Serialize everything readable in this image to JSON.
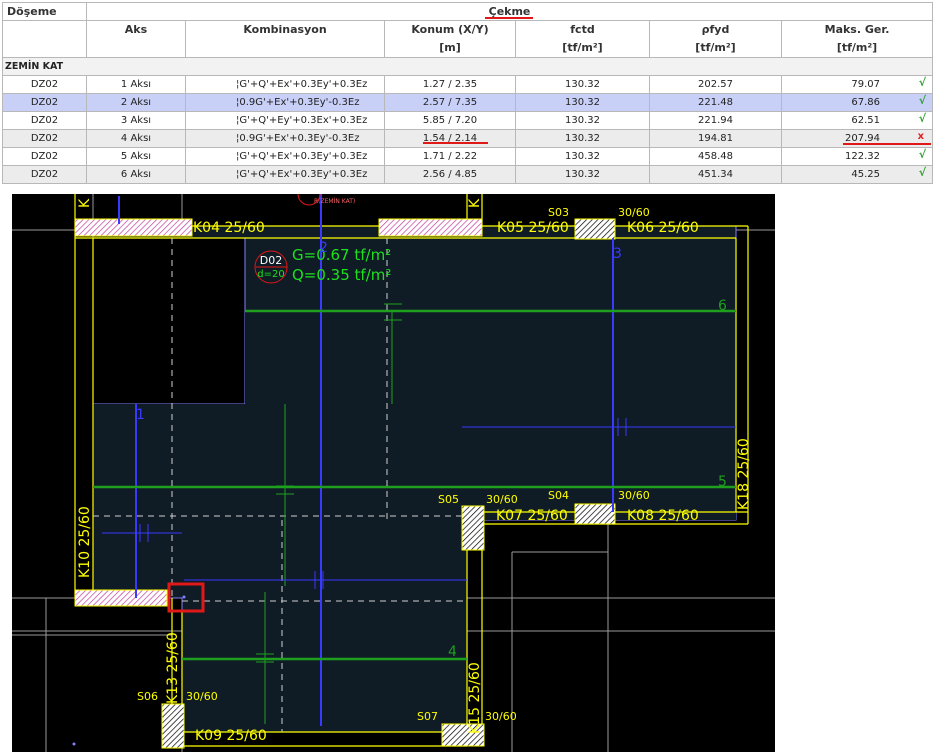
{
  "table": {
    "group_header": {
      "doseme": "Döşeme",
      "cekme": "Çekme"
    },
    "columns": {
      "aks": "Aks",
      "kombinasyon": "Kombinasyon",
      "konum": "Konum (X/Y)",
      "konum_unit": "[m]",
      "fctd": "fctd",
      "fctd_unit": "[tf/m²]",
      "pfyd": "ρfyd",
      "pfyd_unit": "[tf/m²]",
      "maks": "Maks. Ger.",
      "maks_unit": "[tf/m²]"
    },
    "section": "ZEMİN KAT",
    "rows": [
      {
        "doseme": "DZ02",
        "aks": "1 Aksı",
        "komb": "¦G'+Q'+Ex'+0.3Ey'+0.3Ez",
        "konum": "1.27 / 2.35",
        "fctd": "130.32",
        "pfyd": "202.57",
        "maks": "79.07",
        "status": "√"
      },
      {
        "doseme": "DZ02",
        "aks": "2 Aksı",
        "komb": "¦0.9G'+Ex'+0.3Ey'-0.3Ez",
        "konum": "2.57 / 7.35",
        "fctd": "130.32",
        "pfyd": "221.48",
        "maks": "67.86",
        "status": "√"
      },
      {
        "doseme": "DZ02",
        "aks": "3 Aksı",
        "komb": "¦G'+Q'+Ey'+0.3Ex'+0.3Ez",
        "konum": "5.85 / 7.20",
        "fctd": "130.32",
        "pfyd": "221.94",
        "maks": "62.51",
        "status": "√"
      },
      {
        "doseme": "DZ02",
        "aks": "4 Aksı",
        "komb": "¦0.9G'+Ex'+0.3Ey'-0.3Ez",
        "konum": "1.54 / 2.14",
        "fctd": "130.32",
        "pfyd": "194.81",
        "maks": "207.94",
        "status": "x"
      },
      {
        "doseme": "DZ02",
        "aks": "5 Aksı",
        "komb": "¦G'+Q'+Ex'+0.3Ey'+0.3Ez",
        "konum": "1.71 / 2.22",
        "fctd": "130.32",
        "pfyd": "458.48",
        "maks": "122.32",
        "status": "√"
      },
      {
        "doseme": "DZ02",
        "aks": "6 Aksı",
        "komb": "¦G'+Q'+Ex'+0.3Ey'+0.3Ez",
        "konum": "2.56 / 4.85",
        "fctd": "130.32",
        "pfyd": "451.34",
        "maks": "45.25",
        "status": "√"
      }
    ],
    "selected_row": 1
  },
  "cad": {
    "slab_label": "D02",
    "slab_thickness": "d=20",
    "load_g": "G=0.67 tf/m²",
    "load_q": "Q=0.35 tf/m²",
    "floor_tag": "R(ZEMİN KAT)",
    "beams": [
      "K04 25/60",
      "K05 25/60",
      "K06 25/60",
      "K07 25/60",
      "K08 25/60",
      "K09 25/60",
      "K10 25/60",
      "K13 25/60",
      "K15 25/60",
      "K18 25/60"
    ],
    "columns": [
      "S03",
      "S04",
      "S05",
      "S06",
      "S07"
    ],
    "column_size": "30/60",
    "axes": [
      "1",
      "2",
      "3",
      "4",
      "5",
      "6"
    ],
    "colors": {
      "beam": "#ffff00",
      "axis_blue": "#3a3aff",
      "axis_green": "#1ea01e",
      "slab": "#0f1b25",
      "marker": "#e01818"
    }
  }
}
